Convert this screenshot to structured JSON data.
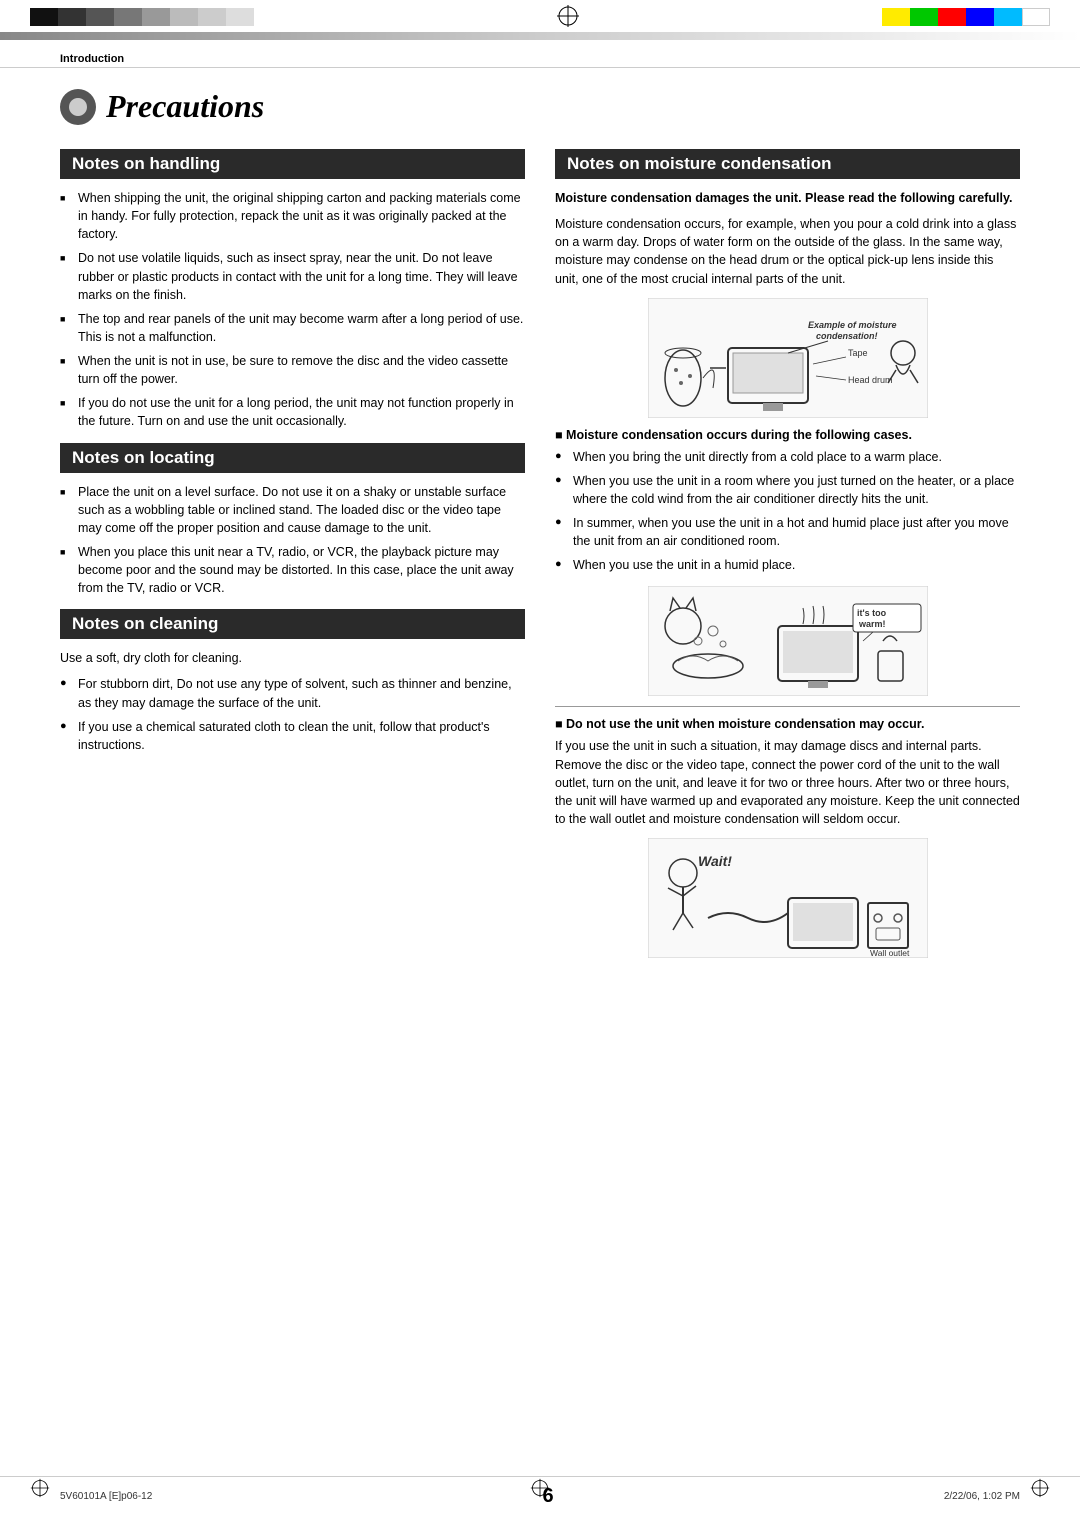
{
  "header": {
    "section_label": "Introduction"
  },
  "page_title": "Precautions",
  "sections": {
    "handling": {
      "title": "Notes on handling",
      "bullets": [
        "When shipping the unit, the original shipping carton and packing materials come in handy. For fully protection, repack the unit as it was originally packed at the factory.",
        "Do not use volatile liquids, such as insect spray, near the unit. Do not leave rubber or plastic products in contact with the unit for a long time. They will leave marks on the finish.",
        "The top and rear panels of the unit may become warm after a long period of use. This is not a malfunction.",
        "When the unit is not in use, be sure to remove the disc and the video cassette turn off the power.",
        "If you do not use the unit for a long period, the unit may not function properly in the future. Turn on and use the unit occasionally."
      ]
    },
    "locating": {
      "title": "Notes on locating",
      "bullets": [
        "Place the unit on a level surface. Do not use it on a shaky or unstable surface such as a wobbling table or inclined stand. The loaded disc or the video tape may come off the proper position and cause damage to the unit.",
        "When you place this unit near a TV, radio, or VCR, the playback picture may become poor and the sound may be distorted. In this case, place the unit away from the TV, radio or VCR."
      ]
    },
    "cleaning": {
      "title": "Notes on cleaning",
      "intro": "Use a soft, dry cloth for cleaning.",
      "bullets": [
        "For stubborn dirt, Do not use any type of solvent, such as thinner and benzine, as they may damage the surface of the unit.",
        "If you use a chemical saturated cloth to clean the unit, follow that product's instructions."
      ]
    },
    "moisture": {
      "title": "Notes on moisture condensation",
      "warning_bold": "Moisture condensation damages the unit. Please read the following carefully.",
      "intro_text": "Moisture condensation occurs, for example, when you pour a cold drink into a glass on a warm day. Drops of water form on the outside of the glass. In the same way, moisture may condense on the head drum or the optical pick-up lens inside this unit, one of the most crucial internal parts of the unit.",
      "illus1_label": "Example of moisture condensation!",
      "illus1_tape": "Tape",
      "illus1_drum": "Head drum",
      "sub_heading1": "Moisture condensation occurs during the following cases.",
      "cases": [
        "When you bring the unit directly from a cold place to a warm place.",
        "When you use the unit in a room where you just turned on the heater, or a place where the cold wind from the air conditioner directly hits the unit.",
        "In summer, when you use the unit in a hot and humid place just after you move the unit from an air conditioned room.",
        "When you use the unit in a humid place."
      ],
      "illus2_label": "it's too warm!",
      "sub_heading2": "Do not use the unit when moisture condensation may occur.",
      "do_not_text": "If you use the unit in such a situation, it may damage discs and internal parts. Remove the disc or the video tape, connect the power cord of the unit to the wall outlet, turn on the unit, and leave it for two or three hours. After two or three hours, the unit will have warmed up and evaporated any moisture. Keep the unit connected to the wall outlet and moisture condensation will seldom occur.",
      "illus3_label": "Wait!",
      "illus3_outlet": "Wall outlet"
    }
  },
  "footer": {
    "page_number": "6",
    "left_text": "5V60101A [E]p06-12",
    "center_text": "6",
    "right_text": "2/22/06, 1:02 PM"
  },
  "colors": {
    "black": "#1a1a1a",
    "dark_header": "#2a2a2a",
    "accent": "#333"
  },
  "color_bars_right": [
    "#ffeb00",
    "#00c800",
    "#ff0000",
    "#0000ff",
    "#00c8ff",
    "#ffffff"
  ],
  "gray_blocks_left": [
    "#1a1a1a",
    "#333",
    "#555",
    "#777",
    "#999",
    "#bbb",
    "#ddd",
    "#fff"
  ]
}
